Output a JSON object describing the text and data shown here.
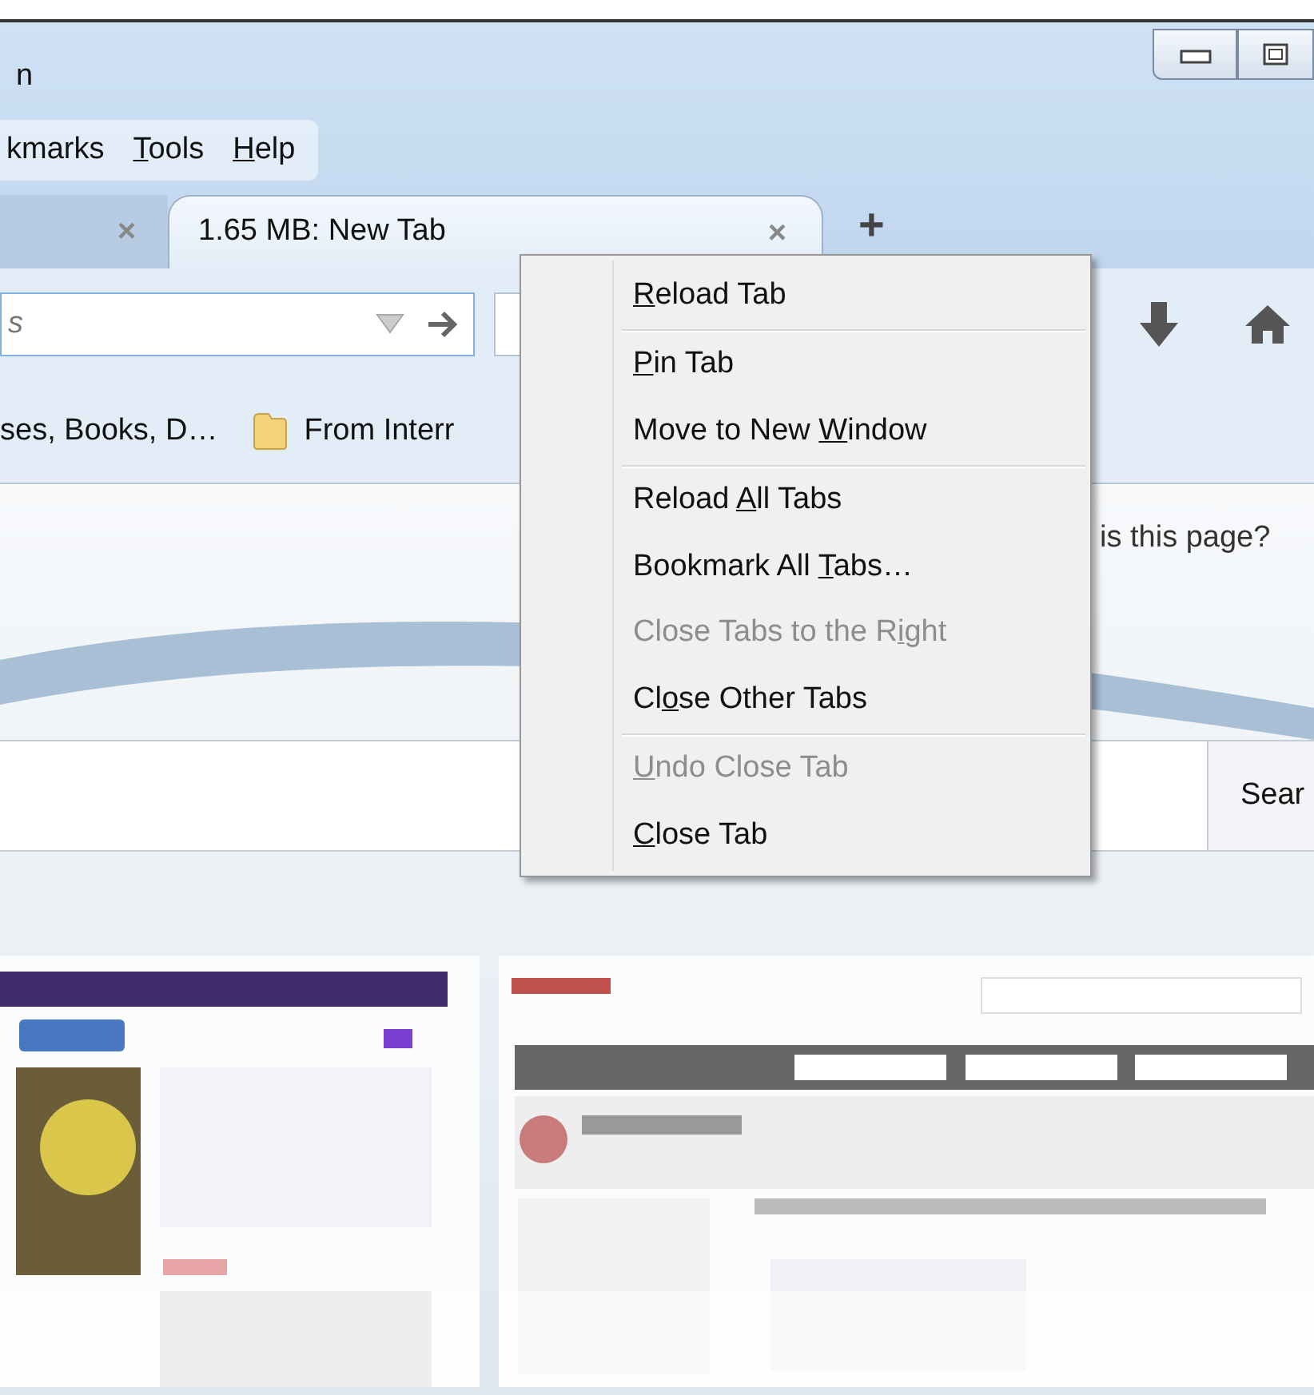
{
  "window": {
    "title": "n"
  },
  "menu_bar": [
    {
      "pre": "kmarks"
    },
    {
      "key": "T",
      "post": "ools"
    },
    {
      "key": "H",
      "post": "elp"
    }
  ],
  "tabs": [
    {
      "close": "×",
      "selected": false
    },
    {
      "label": "1.65 MB: New Tab",
      "close": "×",
      "selected": true
    }
  ],
  "new_tab": "+",
  "url_bar": {
    "placeholder": "s"
  },
  "bookmarks": [
    {
      "label": "ses, Books, D…",
      "kind": "plain"
    },
    {
      "label": "From Interr",
      "kind": "folder"
    }
  ],
  "page": {
    "question": "is this page?",
    "search_button": "Sear"
  },
  "context_menu": [
    {
      "kind": "item",
      "key": "R",
      "post": "eload Tab",
      "disabled": false
    },
    {
      "kind": "separator"
    },
    {
      "kind": "item",
      "key": "P",
      "post": "in Tab",
      "disabled": false
    },
    {
      "kind": "item",
      "pre": "Move to New ",
      "key": "W",
      "post": "indow",
      "disabled": false
    },
    {
      "kind": "separator"
    },
    {
      "kind": "item",
      "pre": "Reload ",
      "key": "A",
      "post": "ll Tabs",
      "disabled": false
    },
    {
      "kind": "item",
      "pre": "Bookmark All ",
      "key": "T",
      "post": "abs…",
      "disabled": false
    },
    {
      "kind": "item",
      "pre": "Close Tabs to the R",
      "key": "i",
      "post": "ght",
      "disabled": true
    },
    {
      "kind": "item",
      "pre": "Cl",
      "key": "o",
      "post": "se Other Tabs",
      "disabled": false
    },
    {
      "kind": "separator"
    },
    {
      "kind": "item",
      "key": "U",
      "post": "ndo Close Tab",
      "disabled": true
    },
    {
      "kind": "item",
      "key": "C",
      "post": "lose Tab",
      "disabled": false
    }
  ]
}
